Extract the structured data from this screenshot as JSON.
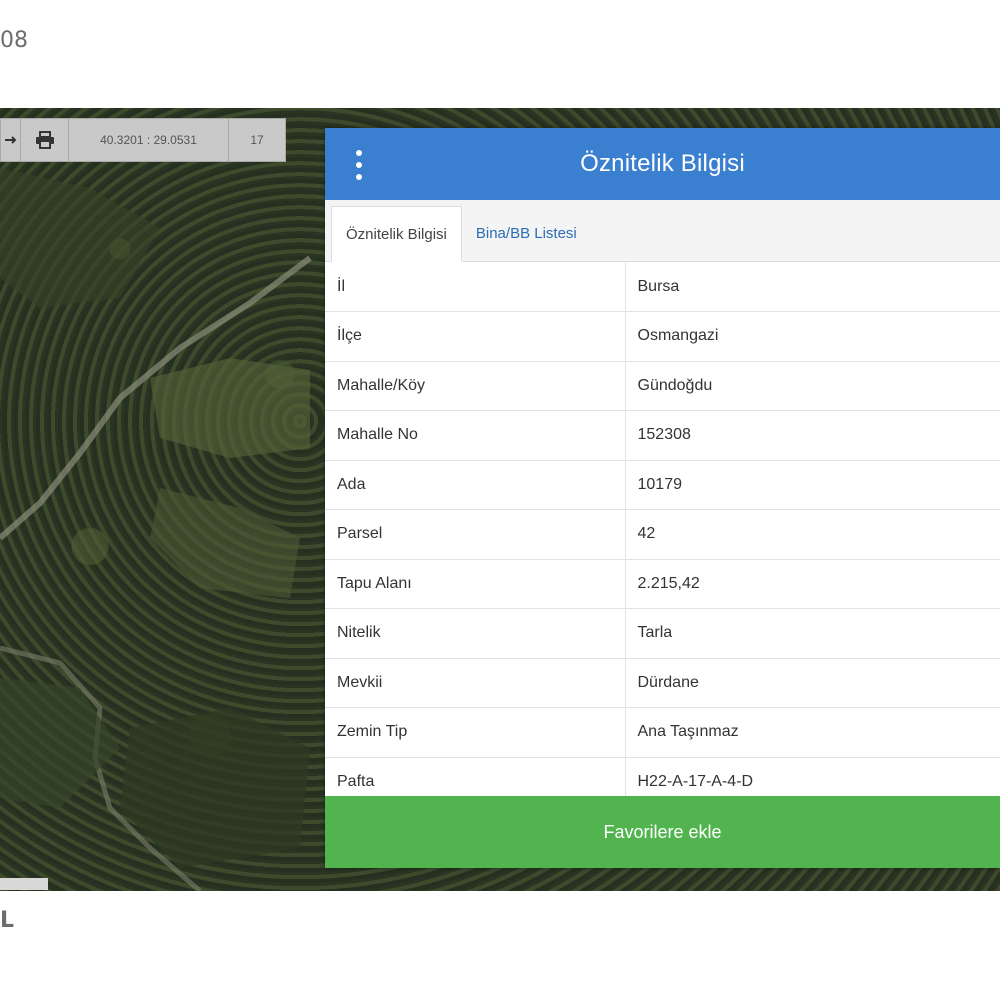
{
  "top_label": "08",
  "bottom_label": "L",
  "map_toolbar": {
    "arrow_icon": "arrow-icon",
    "print_icon": "print-icon",
    "coordinates": "40.3201 : 29.0531",
    "zoom": "17"
  },
  "panel": {
    "title": "Öznitelik Bilgisi",
    "menu_icon": "vertical-dots-icon",
    "header_color": "#3b7fd0",
    "tabs": [
      {
        "label": "Öznitelik Bilgisi",
        "active": true
      },
      {
        "label": "Bina/BB Listesi",
        "active": false
      }
    ],
    "rows": [
      {
        "key": "İl",
        "value": "Bursa"
      },
      {
        "key": "İlçe",
        "value": "Osmangazi"
      },
      {
        "key": "Mahalle/Köy",
        "value": "Gündoğdu"
      },
      {
        "key": "Mahalle No",
        "value": "152308"
      },
      {
        "key": "Ada",
        "value": "10179"
      },
      {
        "key": "Parsel",
        "value": "42"
      },
      {
        "key": "Tapu Alanı",
        "value": "2.215,42"
      },
      {
        "key": "Nitelik",
        "value": "Tarla"
      },
      {
        "key": "Mevkii",
        "value": "Dürdane"
      },
      {
        "key": "Zemin Tip",
        "value": "Ana Taşınmaz"
      },
      {
        "key": "Pafta",
        "value": "H22-A-17-A-4-D"
      }
    ],
    "favorite_button": "Favorilere ekle",
    "favorite_color": "#52b44f"
  }
}
